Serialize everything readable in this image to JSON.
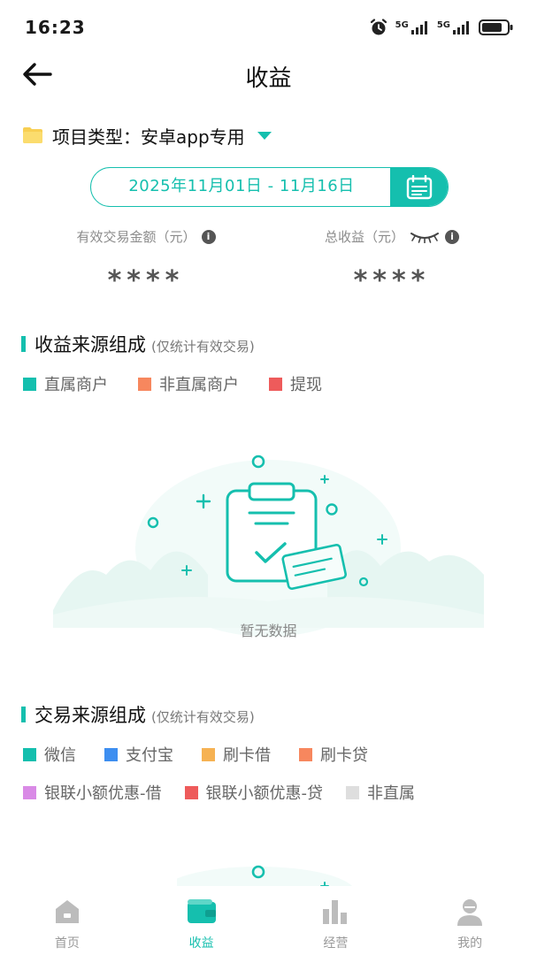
{
  "status_bar": {
    "time": "16:23",
    "network_1": "5G",
    "network_2": "5G"
  },
  "header": {
    "title": "收益"
  },
  "project": {
    "label": "项目类型：",
    "value": "安卓app专用"
  },
  "date_range": {
    "text": "2025年11月01日 - 11月16日"
  },
  "stats": {
    "left": {
      "label": "有效交易金额（元）",
      "value": "****"
    },
    "right": {
      "label": "总收益（元）",
      "value": "****"
    }
  },
  "income_section": {
    "title": "收益来源组成",
    "subtitle": "(仅统计有效交易)",
    "legend": [
      {
        "label": "直属商户",
        "color": "#14bfae"
      },
      {
        "label": "非直属商户",
        "color": "#f7875e"
      },
      {
        "label": "提现",
        "color": "#ee5b5b"
      }
    ],
    "empty_text": "暂无数据"
  },
  "trade_section": {
    "title": "交易来源组成",
    "subtitle": "(仅统计有效交易)",
    "legend_row1": [
      {
        "label": "微信",
        "color": "#14bfae"
      },
      {
        "label": "支付宝",
        "color": "#3d8ef0"
      },
      {
        "label": "刷卡借",
        "color": "#f6b253"
      },
      {
        "label": "刷卡贷",
        "color": "#f7875e"
      }
    ],
    "legend_row2": [
      {
        "label": "银联小额优惠-借",
        "color": "#d98ae6"
      },
      {
        "label": "银联小额优惠-贷",
        "color": "#ee5b5b"
      },
      {
        "label": "非直属",
        "color": "#dedede"
      }
    ]
  },
  "tabs": [
    {
      "label": "首页",
      "icon": "home-icon",
      "active": false
    },
    {
      "label": "收益",
      "icon": "wallet-icon",
      "active": true
    },
    {
      "label": "经营",
      "icon": "bar-chart-icon",
      "active": false
    },
    {
      "label": "我的",
      "icon": "user-icon",
      "active": false
    }
  ],
  "colors": {
    "accent": "#15bfae",
    "inactive_tab": "#bcbcbc"
  }
}
